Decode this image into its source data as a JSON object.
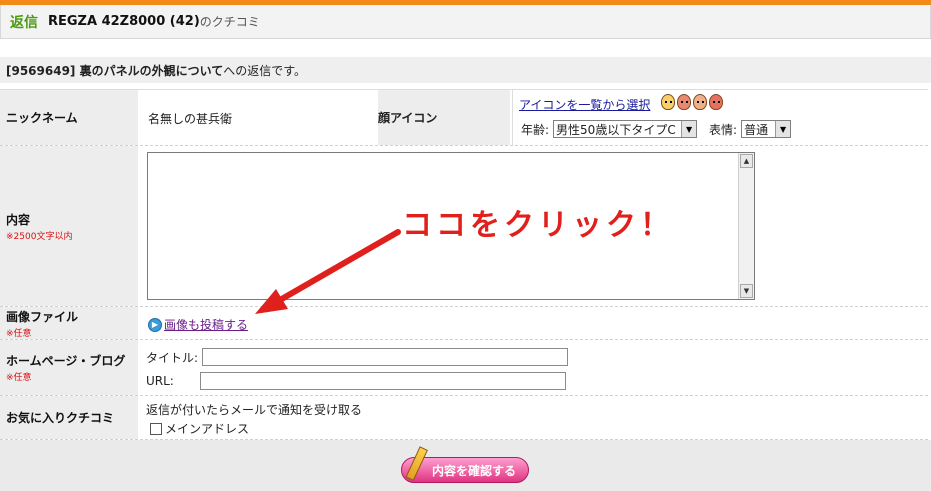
{
  "header": {
    "reply_label": "返信",
    "product": "REGZA 42Z8000 (42)",
    "suffix": "のクチコミ"
  },
  "subheader": {
    "thread": "[9569649] 裏のパネルの外観について",
    "text": "への返信です。"
  },
  "form": {
    "nickname": {
      "label": "ニックネーム",
      "value": "名無しの甚兵衛"
    },
    "face_icon": {
      "label": "顔アイコン",
      "list_link": "アイコンを一覧から選択",
      "age_label": "年齢:",
      "age_value": "男性50歳以下タイプC",
      "expression_label": "表情:",
      "expression_value": "普通"
    },
    "content": {
      "label": "内容",
      "note": "※2500文字以内"
    },
    "image": {
      "label": "画像ファイル",
      "note": "※任意",
      "link": "画像も投稿する"
    },
    "homepage": {
      "label": "ホームページ・ブログ",
      "note": "※任意",
      "title_label": "タイトル:",
      "url_label": "URL:"
    },
    "favorite": {
      "label": "お気に入りクチコミ",
      "text": "返信が付いたらメールで通知を受け取る",
      "checkbox_label": "メインアドレス"
    }
  },
  "confirm_button": "内容を確認する",
  "annotation": "ココをクリック！",
  "colors": {
    "accent_orange": "#f28a1a",
    "reply_green": "#4b9b12",
    "annotation_red": "#e0201c",
    "button_pink": "#e0357f"
  }
}
